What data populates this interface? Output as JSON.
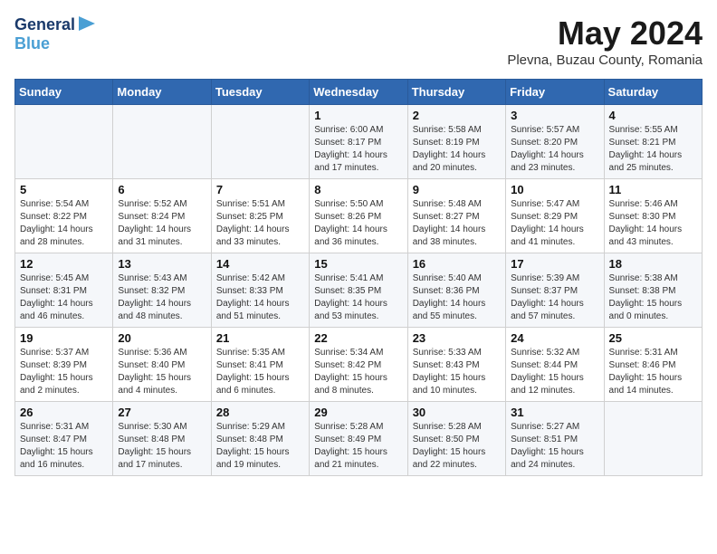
{
  "logo": {
    "line1": "General",
    "line2": "Blue"
  },
  "title": "May 2024",
  "location": "Plevna, Buzau County, Romania",
  "days_of_week": [
    "Sunday",
    "Monday",
    "Tuesday",
    "Wednesday",
    "Thursday",
    "Friday",
    "Saturday"
  ],
  "weeks": [
    [
      {
        "day": "",
        "sunrise": "",
        "sunset": "",
        "daylight": ""
      },
      {
        "day": "",
        "sunrise": "",
        "sunset": "",
        "daylight": ""
      },
      {
        "day": "",
        "sunrise": "",
        "sunset": "",
        "daylight": ""
      },
      {
        "day": "1",
        "sunrise": "Sunrise: 6:00 AM",
        "sunset": "Sunset: 8:17 PM",
        "daylight": "Daylight: 14 hours and 17 minutes."
      },
      {
        "day": "2",
        "sunrise": "Sunrise: 5:58 AM",
        "sunset": "Sunset: 8:19 PM",
        "daylight": "Daylight: 14 hours and 20 minutes."
      },
      {
        "day": "3",
        "sunrise": "Sunrise: 5:57 AM",
        "sunset": "Sunset: 8:20 PM",
        "daylight": "Daylight: 14 hours and 23 minutes."
      },
      {
        "day": "4",
        "sunrise": "Sunrise: 5:55 AM",
        "sunset": "Sunset: 8:21 PM",
        "daylight": "Daylight: 14 hours and 25 minutes."
      }
    ],
    [
      {
        "day": "5",
        "sunrise": "Sunrise: 5:54 AM",
        "sunset": "Sunset: 8:22 PM",
        "daylight": "Daylight: 14 hours and 28 minutes."
      },
      {
        "day": "6",
        "sunrise": "Sunrise: 5:52 AM",
        "sunset": "Sunset: 8:24 PM",
        "daylight": "Daylight: 14 hours and 31 minutes."
      },
      {
        "day": "7",
        "sunrise": "Sunrise: 5:51 AM",
        "sunset": "Sunset: 8:25 PM",
        "daylight": "Daylight: 14 hours and 33 minutes."
      },
      {
        "day": "8",
        "sunrise": "Sunrise: 5:50 AM",
        "sunset": "Sunset: 8:26 PM",
        "daylight": "Daylight: 14 hours and 36 minutes."
      },
      {
        "day": "9",
        "sunrise": "Sunrise: 5:48 AM",
        "sunset": "Sunset: 8:27 PM",
        "daylight": "Daylight: 14 hours and 38 minutes."
      },
      {
        "day": "10",
        "sunrise": "Sunrise: 5:47 AM",
        "sunset": "Sunset: 8:29 PM",
        "daylight": "Daylight: 14 hours and 41 minutes."
      },
      {
        "day": "11",
        "sunrise": "Sunrise: 5:46 AM",
        "sunset": "Sunset: 8:30 PM",
        "daylight": "Daylight: 14 hours and 43 minutes."
      }
    ],
    [
      {
        "day": "12",
        "sunrise": "Sunrise: 5:45 AM",
        "sunset": "Sunset: 8:31 PM",
        "daylight": "Daylight: 14 hours and 46 minutes."
      },
      {
        "day": "13",
        "sunrise": "Sunrise: 5:43 AM",
        "sunset": "Sunset: 8:32 PM",
        "daylight": "Daylight: 14 hours and 48 minutes."
      },
      {
        "day": "14",
        "sunrise": "Sunrise: 5:42 AM",
        "sunset": "Sunset: 8:33 PM",
        "daylight": "Daylight: 14 hours and 51 minutes."
      },
      {
        "day": "15",
        "sunrise": "Sunrise: 5:41 AM",
        "sunset": "Sunset: 8:35 PM",
        "daylight": "Daylight: 14 hours and 53 minutes."
      },
      {
        "day": "16",
        "sunrise": "Sunrise: 5:40 AM",
        "sunset": "Sunset: 8:36 PM",
        "daylight": "Daylight: 14 hours and 55 minutes."
      },
      {
        "day": "17",
        "sunrise": "Sunrise: 5:39 AM",
        "sunset": "Sunset: 8:37 PM",
        "daylight": "Daylight: 14 hours and 57 minutes."
      },
      {
        "day": "18",
        "sunrise": "Sunrise: 5:38 AM",
        "sunset": "Sunset: 8:38 PM",
        "daylight": "Daylight: 15 hours and 0 minutes."
      }
    ],
    [
      {
        "day": "19",
        "sunrise": "Sunrise: 5:37 AM",
        "sunset": "Sunset: 8:39 PM",
        "daylight": "Daylight: 15 hours and 2 minutes."
      },
      {
        "day": "20",
        "sunrise": "Sunrise: 5:36 AM",
        "sunset": "Sunset: 8:40 PM",
        "daylight": "Daylight: 15 hours and 4 minutes."
      },
      {
        "day": "21",
        "sunrise": "Sunrise: 5:35 AM",
        "sunset": "Sunset: 8:41 PM",
        "daylight": "Daylight: 15 hours and 6 minutes."
      },
      {
        "day": "22",
        "sunrise": "Sunrise: 5:34 AM",
        "sunset": "Sunset: 8:42 PM",
        "daylight": "Daylight: 15 hours and 8 minutes."
      },
      {
        "day": "23",
        "sunrise": "Sunrise: 5:33 AM",
        "sunset": "Sunset: 8:43 PM",
        "daylight": "Daylight: 15 hours and 10 minutes."
      },
      {
        "day": "24",
        "sunrise": "Sunrise: 5:32 AM",
        "sunset": "Sunset: 8:44 PM",
        "daylight": "Daylight: 15 hours and 12 minutes."
      },
      {
        "day": "25",
        "sunrise": "Sunrise: 5:31 AM",
        "sunset": "Sunset: 8:46 PM",
        "daylight": "Daylight: 15 hours and 14 minutes."
      }
    ],
    [
      {
        "day": "26",
        "sunrise": "Sunrise: 5:31 AM",
        "sunset": "Sunset: 8:47 PM",
        "daylight": "Daylight: 15 hours and 16 minutes."
      },
      {
        "day": "27",
        "sunrise": "Sunrise: 5:30 AM",
        "sunset": "Sunset: 8:48 PM",
        "daylight": "Daylight: 15 hours and 17 minutes."
      },
      {
        "day": "28",
        "sunrise": "Sunrise: 5:29 AM",
        "sunset": "Sunset: 8:48 PM",
        "daylight": "Daylight: 15 hours and 19 minutes."
      },
      {
        "day": "29",
        "sunrise": "Sunrise: 5:28 AM",
        "sunset": "Sunset: 8:49 PM",
        "daylight": "Daylight: 15 hours and 21 minutes."
      },
      {
        "day": "30",
        "sunrise": "Sunrise: 5:28 AM",
        "sunset": "Sunset: 8:50 PM",
        "daylight": "Daylight: 15 hours and 22 minutes."
      },
      {
        "day": "31",
        "sunrise": "Sunrise: 5:27 AM",
        "sunset": "Sunset: 8:51 PM",
        "daylight": "Daylight: 15 hours and 24 minutes."
      },
      {
        "day": "",
        "sunrise": "",
        "sunset": "",
        "daylight": ""
      }
    ]
  ]
}
